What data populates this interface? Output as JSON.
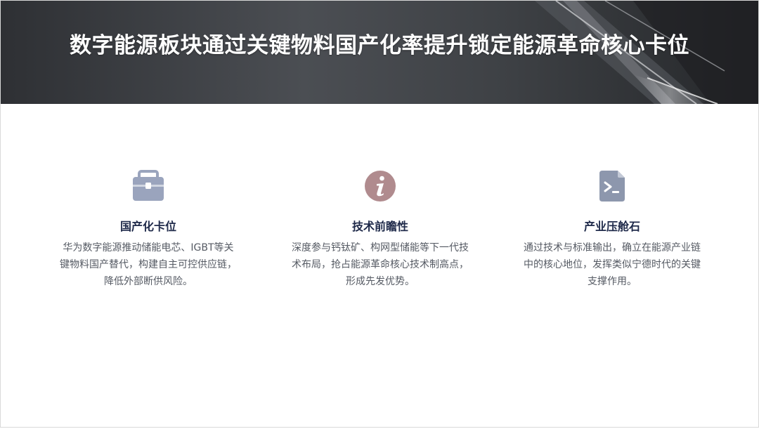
{
  "slide": {
    "title": "数字能源板块通过关键物料国产化率提升锁定能源革命核心卡位"
  },
  "cards": [
    {
      "icon": "briefcase-icon",
      "icon_color": "#9aa4bd",
      "title": "国产化卡位",
      "desc_lines": [
        "华为数字能源推动储能电芯、IGBT等关",
        "键物料国产替代，构建自主可控供应链，",
        "降低外部断供风险。"
      ]
    },
    {
      "icon": "info-icon",
      "icon_color": "#b08b8e",
      "title": "技术前瞻性",
      "desc_lines": [
        "深度参与钙钛矿、构网型储能等下一代技",
        "术布局，抢占能源革命核心技术制高点，",
        "形成先发优势。"
      ]
    },
    {
      "icon": "terminal-file-icon",
      "icon_color": "#8d97ad",
      "title": "产业压舱石",
      "desc_lines": [
        "通过技术与标准输出，确立在能源产业链",
        "中的核心地位，发挥类似宁德时代的关键",
        "支撑作用。"
      ]
    }
  ]
}
